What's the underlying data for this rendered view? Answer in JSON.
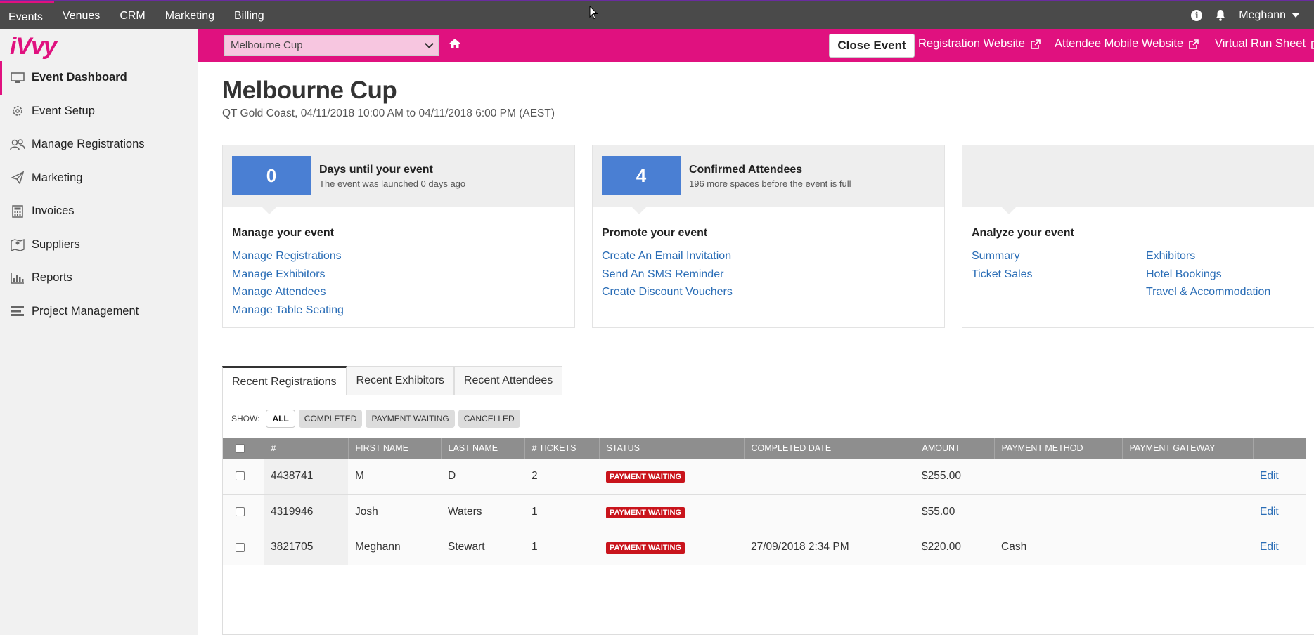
{
  "topnav": {
    "items": [
      {
        "label": "Events"
      },
      {
        "label": "Venues"
      },
      {
        "label": "CRM"
      },
      {
        "label": "Marketing"
      },
      {
        "label": "Billing"
      }
    ],
    "user_name": "Meghann"
  },
  "sidebar": {
    "logo": "iVvy",
    "items": [
      {
        "label": "Event Dashboard",
        "icon": "monitor-icon"
      },
      {
        "label": "Event Setup",
        "icon": "gear-icon"
      },
      {
        "label": "Manage Registrations",
        "icon": "users-icon"
      },
      {
        "label": "Marketing",
        "icon": "paper-plane-icon"
      },
      {
        "label": "Invoices",
        "icon": "calculator-icon"
      },
      {
        "label": "Suppliers",
        "icon": "map-pin-icon"
      },
      {
        "label": "Reports",
        "icon": "bar-chart-icon"
      },
      {
        "label": "Project Management",
        "icon": "tasks-icon"
      }
    ]
  },
  "eventbar": {
    "selected_event": "Melbourne Cup",
    "close_event": "Close Event",
    "registration_website": "Registration Website",
    "attendee_mobile_website": "Attendee Mobile Website",
    "virtual_run_sheet": "Virtual Run Sheet"
  },
  "page": {
    "title": "Melbourne Cup",
    "subtitle": "QT Gold Coast, 04/11/2018 10:00 AM to 04/11/2018 6:00 PM (AEST)"
  },
  "cards": {
    "manage": {
      "stat_value": "0",
      "stat_title": "Days until your event",
      "stat_sub": "The event was launched 0 days ago",
      "section_title": "Manage your event",
      "links": [
        "Manage Registrations",
        "Manage Exhibitors",
        "Manage Attendees",
        "Manage Table Seating"
      ]
    },
    "promote": {
      "stat_value": "4",
      "stat_title": "Confirmed Attendees",
      "stat_sub": "196 more spaces before the event is full",
      "section_title": "Promote your event",
      "links": [
        "Create An Email Invitation",
        "Send An SMS Reminder",
        "Create Discount Vouchers"
      ]
    },
    "analyze": {
      "section_title": "Analyze your event",
      "links_col1": [
        "Summary",
        "Ticket Sales"
      ],
      "links_col2": [
        "Exhibitors",
        "Hotel Bookings",
        "Travel & Accommodation"
      ]
    }
  },
  "tabs": [
    "Recent Registrations",
    "Recent Exhibitors",
    "Recent Attendees"
  ],
  "filters": {
    "show_label": "SHOW:",
    "options": [
      "ALL",
      "COMPLETED",
      "PAYMENT WAITING",
      "CANCELLED"
    ]
  },
  "table": {
    "headers": [
      "#",
      "FIRST NAME",
      "LAST NAME",
      "# TICKETS",
      "STATUS",
      "COMPLETED DATE",
      "AMOUNT",
      "PAYMENT METHOD",
      "PAYMENT GATEWAY"
    ],
    "rows": [
      {
        "id": "4438741",
        "first": "M",
        "last": "D",
        "tickets": "2",
        "status": "PAYMENT WAITING",
        "completed": "",
        "amount": "$255.00",
        "method": "",
        "gateway": "",
        "action": "Edit"
      },
      {
        "id": "4319946",
        "first": "Josh",
        "last": "Waters",
        "tickets": "1",
        "status": "PAYMENT WAITING",
        "completed": "",
        "amount": "$55.00",
        "method": "",
        "gateway": "",
        "action": "Edit"
      },
      {
        "id": "3821705",
        "first": "Meghann",
        "last": "Stewart",
        "tickets": "1",
        "status": "PAYMENT WAITING",
        "completed": "27/09/2018 2:34 PM",
        "amount": "$220.00",
        "method": "Cash",
        "gateway": "",
        "action": "Edit"
      }
    ]
  },
  "colors": {
    "brand": "#e0117f",
    "stat_blue": "#4a7fd3",
    "link": "#2a6db6",
    "badge_red": "#c9141c",
    "topnav": "#4a4a4a"
  }
}
